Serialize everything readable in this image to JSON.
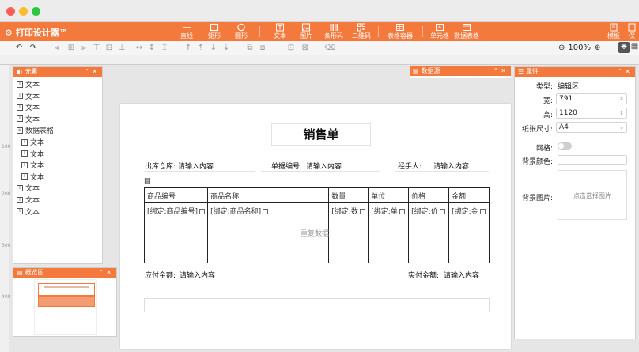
{
  "app": {
    "title": "打印设计器™"
  },
  "colors": {
    "accent": "#f37a3c",
    "window_red": "#fd5f57",
    "window_yellow": "#febc2e",
    "window_green": "#28c840"
  },
  "toolbar": {
    "buttons": [
      {
        "label": "直线",
        "icon": "line-icon"
      },
      {
        "label": "矩形",
        "icon": "rect-icon"
      },
      {
        "label": "圆形",
        "icon": "circle-icon"
      },
      {
        "label": "文本",
        "icon": "text-icon"
      },
      {
        "label": "图片",
        "icon": "image-icon"
      },
      {
        "label": "条形码",
        "icon": "barcode-icon"
      },
      {
        "label": "二维码",
        "icon": "qrcode-icon"
      },
      {
        "label": "表格容器",
        "icon": "table-icon"
      },
      {
        "label": "单元格",
        "icon": "cell-icon"
      },
      {
        "label": "数据表格",
        "icon": "datatable-icon"
      },
      {
        "label": "模板",
        "icon": "template-icon"
      },
      {
        "label": "保",
        "icon": "save-icon"
      }
    ]
  },
  "zoom": {
    "value": "100%"
  },
  "ruler": {
    "marks": [
      "100",
      "200",
      "300",
      "400"
    ]
  },
  "elements_panel": {
    "title": "元素",
    "items": [
      {
        "label": "文本",
        "indent": 0
      },
      {
        "label": "文本",
        "indent": 0
      },
      {
        "label": "文本",
        "indent": 0
      },
      {
        "label": "文本",
        "indent": 0
      },
      {
        "label": "数据表格",
        "indent": 0
      },
      {
        "label": "文本",
        "indent": 1
      },
      {
        "label": "文本",
        "indent": 1
      },
      {
        "label": "文本",
        "indent": 1
      },
      {
        "label": "文本",
        "indent": 1
      },
      {
        "label": "文本",
        "indent": 0
      },
      {
        "label": "文本",
        "indent": 0
      },
      {
        "label": "文本",
        "indent": 0
      }
    ]
  },
  "preview_panel": {
    "title": "概览图"
  },
  "datasource_panel": {
    "title": "数据源"
  },
  "properties_panel": {
    "title": "属性",
    "type_label": "类型:",
    "type_value": "编辑区",
    "width_label": "宽:",
    "width_value": "791",
    "height_label": "高:",
    "height_value": "1120",
    "paper_label": "纸张尺寸:",
    "paper_value": "A4",
    "grid_label": "网格:",
    "bgcolor_label": "背景颜色:",
    "bgimage_label": "背景图片:",
    "bgimage_hint": "点击选择图片"
  },
  "document": {
    "title": "销售单",
    "warehouse_label": "出库仓库:",
    "warehouse_value": "请输入内容",
    "order_label": "单据编号:",
    "order_value": "请输入内容",
    "handler_label": "经手人:",
    "handler_value": "请输入内容",
    "columns": [
      "商品编号",
      "商品名称",
      "数量",
      "单位",
      "价格",
      "金额"
    ],
    "bind_row": [
      "[绑定:商品编号]",
      "[绑定:商品名称]",
      "[绑定:数",
      "[绑定:单",
      "[绑定:价",
      "[绑定:金"
    ],
    "repeat_label": "重复数据",
    "payable_label": "应付金额:",
    "payable_value": "请输入内容",
    "paid_label": "实付金额:",
    "paid_value": "请输入内容"
  }
}
